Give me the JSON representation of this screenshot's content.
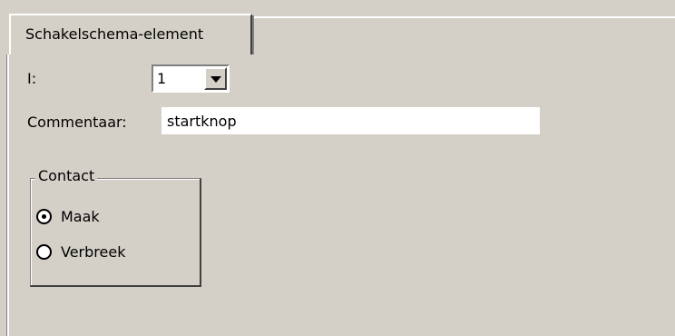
{
  "tab": {
    "label": "Schakelschema-element"
  },
  "fields": {
    "i_label": "I:",
    "i_value": "1",
    "comment_label": "Commentaar:",
    "comment_value": "startknop"
  },
  "contact": {
    "title": "Contact",
    "options": [
      {
        "label": "Maak",
        "selected": true
      },
      {
        "label": "Verbreek",
        "selected": false
      }
    ]
  },
  "icons": {
    "dropdown": "chevron-down-icon",
    "radio_selected": "radio-selected-icon",
    "radio_unselected": "radio-unselected-icon"
  },
  "colors": {
    "background": "#d4d0c8",
    "field_background": "#ffffff",
    "text": "#000000"
  }
}
